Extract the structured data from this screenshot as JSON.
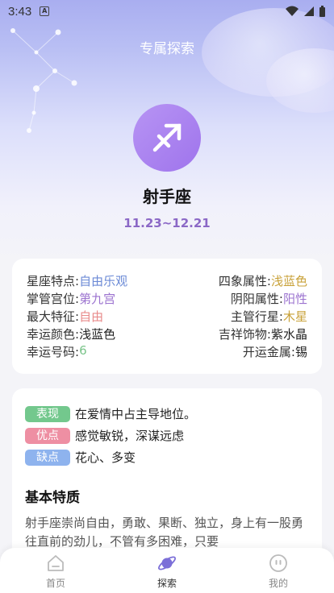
{
  "status": {
    "time": "3:43",
    "a_badge": "A"
  },
  "header": {
    "title": "专属探索"
  },
  "sign": {
    "symbol_icon": "sagittarius-icon",
    "name": "射手座",
    "date_range": "11.23~12.21"
  },
  "info": {
    "rows": [
      {
        "left_label": "星座特点:",
        "left_value": "自由乐观",
        "right_label": "四象属性:",
        "right_value": "浅蓝色"
      },
      {
        "left_label": "掌管宫位:",
        "left_value": "第九宫",
        "right_label": "阴阳属性:",
        "right_value": "阳性"
      },
      {
        "left_label": "最大特征:",
        "left_value": "自由",
        "right_label": "主管行星:",
        "right_value": "木星"
      },
      {
        "left_label": "幸运颜色:",
        "left_value": "浅蓝色",
        "right_label": "吉祥饰物:",
        "right_value": "紫水晶"
      },
      {
        "left_label": "幸运号码:",
        "left_value": "6",
        "right_label": "开运金属:",
        "right_value": "锡"
      }
    ]
  },
  "traits": {
    "tags": [
      {
        "label": "表现",
        "text": "在爱情中占主导地位。",
        "color": "#73c88d"
      },
      {
        "label": "优点",
        "text": "感觉敏锐，深谋远虑",
        "color": "#ee8fa3"
      },
      {
        "label": "缺点",
        "text": "花心、多变",
        "color": "#8eb3ee"
      }
    ],
    "section_title": "基本特质",
    "section_body": "射手座崇尚自由，勇敢、果断、独立，身上有一股勇往直前的劲儿，不管有多困难，只要"
  },
  "nav": {
    "items": [
      {
        "label": "首页",
        "icon": "home-icon"
      },
      {
        "label": "探索",
        "icon": "planet-icon"
      },
      {
        "label": "我的",
        "icon": "profile-icon"
      }
    ]
  }
}
